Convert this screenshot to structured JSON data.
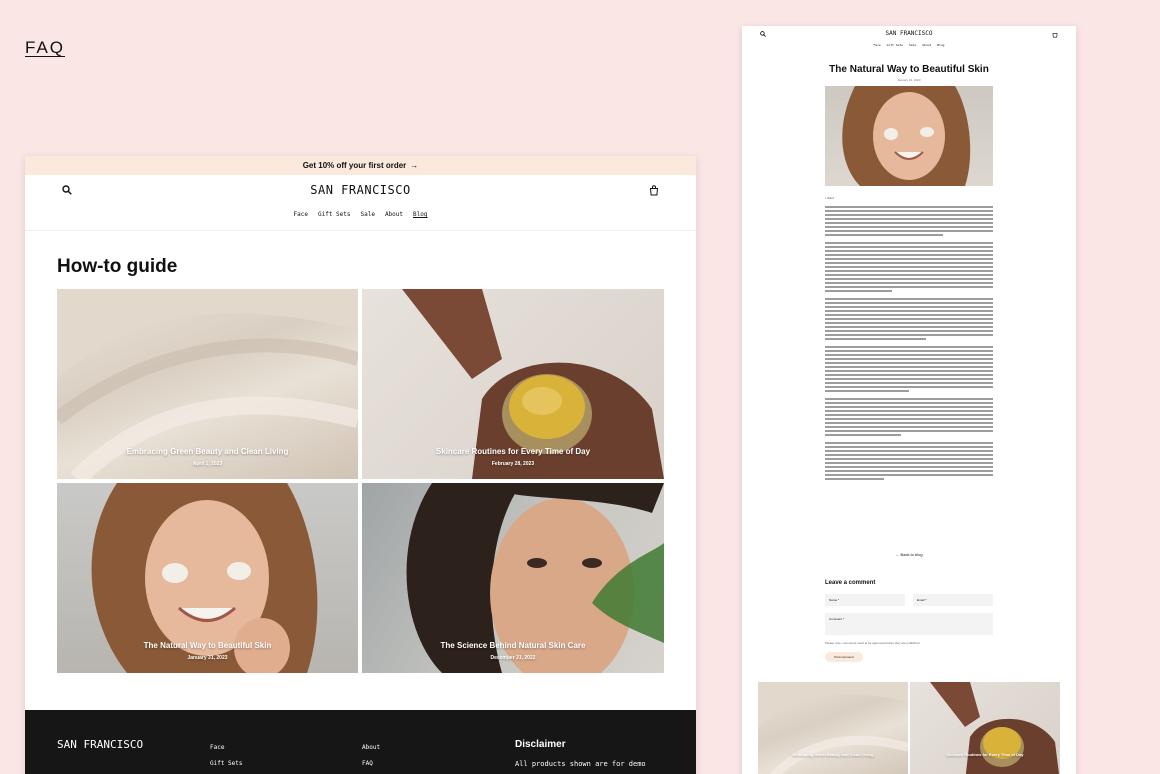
{
  "page": {
    "faq_link": "FAQ"
  },
  "desktop": {
    "announcement": "Get 10% off your first order",
    "announcement_arrow": "→",
    "logo": "SAN FRANCISCO",
    "nav": [
      {
        "label": "Face",
        "active": false
      },
      {
        "label": "Gift Sets",
        "active": false
      },
      {
        "label": "Sale",
        "active": false
      },
      {
        "label": "About",
        "active": false
      },
      {
        "label": "Blog",
        "active": true
      }
    ],
    "heading": "How-to guide",
    "posts": [
      {
        "title": "Embracing Green Beauty and Clean Living",
        "date": "April 1, 2023"
      },
      {
        "title": "Skincare Routines for Every Time of Day",
        "date": "February 28, 2023"
      },
      {
        "title": "The Natural Way to Beautiful Skin",
        "date": "January 31, 2023"
      },
      {
        "title": "The Science Behind Natural Skin Care",
        "date": "December 31, 2022"
      }
    ],
    "footer": {
      "logo": "SAN FRANCISCO",
      "col1": [
        "Face",
        "Gift Sets"
      ],
      "col2": [
        "About",
        "FAQ"
      ],
      "disclaimer_title": "Disclaimer",
      "disclaimer_text": "All products shown are for demo"
    }
  },
  "article": {
    "logo": "SAN FRANCISCO",
    "nav": [
      "Face",
      "Gift Sets",
      "Sale",
      "About",
      "Blog"
    ],
    "title": "The Natural Way to Beautiful Skin",
    "date": "January 31, 2023",
    "author": "I. Bard",
    "back_link": "← Back to blog",
    "leave_comment": "Leave a comment",
    "name_placeholder": "Name *",
    "email_placeholder": "Email *",
    "comment_placeholder": "Comment *",
    "note": "Please note, comments need to be approved before they are published.",
    "post_button": "Post comment",
    "thumbs": [
      {
        "title": "Embracing Green Beauty and Clean Living"
      },
      {
        "title": "Skincare Routines for Every Time of Day"
      }
    ]
  }
}
